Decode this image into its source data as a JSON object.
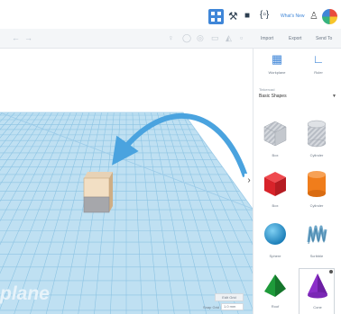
{
  "header": {
    "whats_new_label": "What's New",
    "tools": [
      "grid-view",
      "hammer",
      "briefcase",
      "code-blocks"
    ]
  },
  "toolbar": {
    "import_label": "Import",
    "export_label": "Export",
    "send_to_label": "Send To"
  },
  "panel": {
    "workplane_label": "Workplane",
    "ruler_label": "Ruler",
    "library_caption": "Tinkercad",
    "library_selected": "Basic Shapes",
    "shapes": [
      {
        "name": "Box",
        "kind": "box-hole"
      },
      {
        "name": "Cylinder",
        "kind": "cylinder-hole"
      },
      {
        "name": "Box",
        "kind": "box-red"
      },
      {
        "name": "Cylinder",
        "kind": "cylinder-orange"
      },
      {
        "name": "Sphere",
        "kind": "sphere"
      },
      {
        "name": "Scribble",
        "kind": "scribble"
      },
      {
        "name": "Roof",
        "kind": "roof"
      },
      {
        "name": "Cone",
        "kind": "cone"
      }
    ]
  },
  "canvas": {
    "workplane_watermark": "plane",
    "edit_grid_label": "Edit Grid",
    "snap_grid_label": "Snap Grid",
    "snap_grid_value": "1.0 mm"
  },
  "colors": {
    "accent": "#3f86d8",
    "workplane": "#bfe0f2",
    "grid_line": "#8cc3e3",
    "arrow": "#4aa3df",
    "red_box": "#d8232a",
    "orange_cylinder": "#f07d1b",
    "sphere": "#1f9bd6",
    "scribble": "#6ea7c9",
    "roof": "#1e9a3a",
    "cone": "#8b2fc9"
  }
}
